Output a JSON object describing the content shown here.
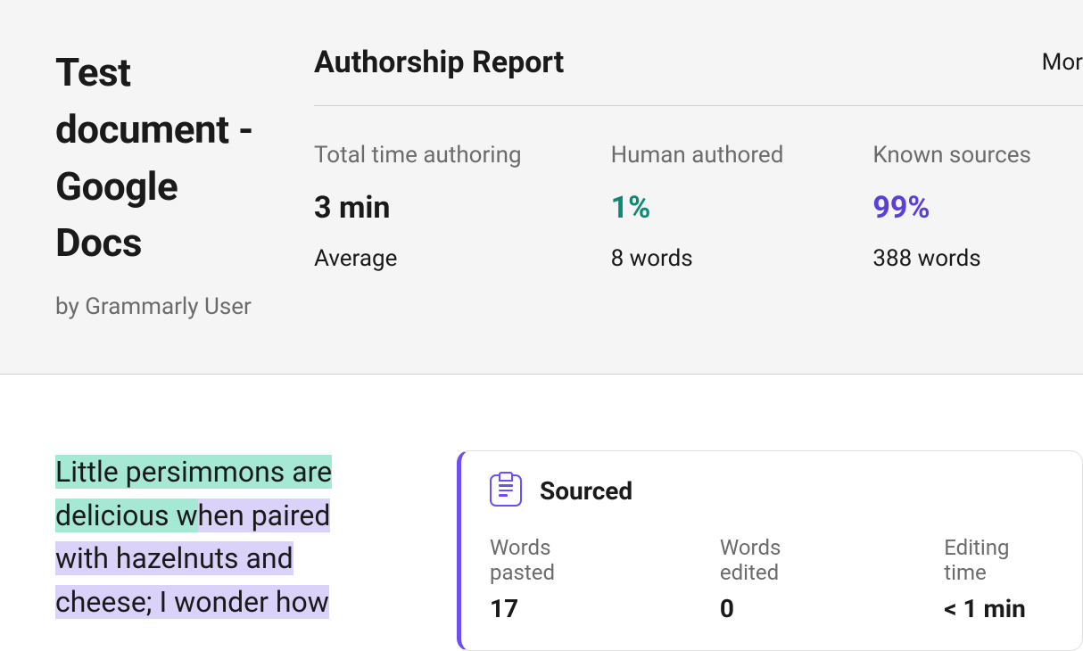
{
  "doc": {
    "title": "Test document - Google Docs",
    "author": "by Grammarly User"
  },
  "report": {
    "title": "Authorship Report",
    "more": "Mor",
    "stats": {
      "time": {
        "label": "Total time authoring",
        "value": "3 min",
        "sub": "Average"
      },
      "human": {
        "label": "Human authored",
        "value": "1%",
        "sub": "8 words"
      },
      "sources": {
        "label": "Known sources",
        "value": "99%",
        "sub": "388 words"
      }
    }
  },
  "excerpt": {
    "seg1": "Little persimmons are delicious w",
    "seg2": "hen paired with hazelnuts and cheese; I wonder how"
  },
  "sourced": {
    "title": "Sourced",
    "pasted": {
      "label": "Words pasted",
      "value": "17"
    },
    "edited": {
      "label": "Words edited",
      "value": "0"
    },
    "etime": {
      "label": "Editing time",
      "value": "< 1 min"
    }
  }
}
